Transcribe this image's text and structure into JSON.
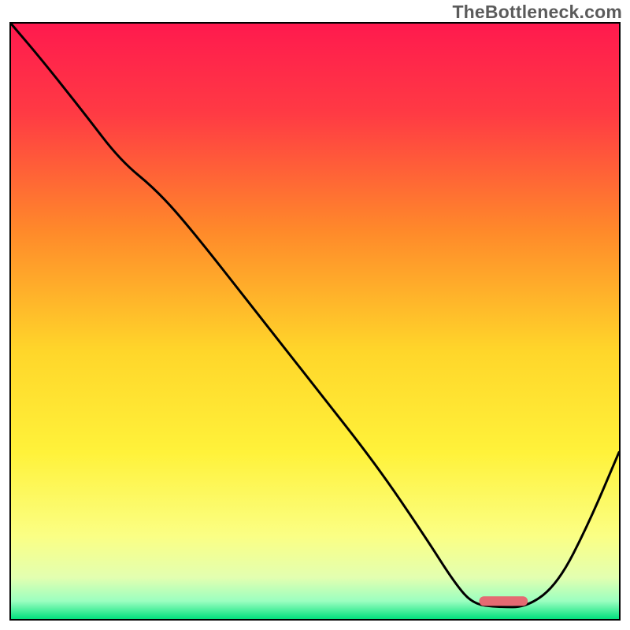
{
  "attribution": "TheBottleneck.com",
  "chart_data": {
    "type": "line",
    "title": "",
    "xlabel": "",
    "ylabel": "",
    "xlim": [
      0,
      100
    ],
    "ylim": [
      0,
      100
    ],
    "grid": false,
    "legend": false,
    "background_gradient": {
      "stops": [
        {
          "offset": 0.0,
          "color": "#ff1a4e"
        },
        {
          "offset": 0.15,
          "color": "#ff3a44"
        },
        {
          "offset": 0.35,
          "color": "#ff8a2a"
        },
        {
          "offset": 0.55,
          "color": "#ffd62a"
        },
        {
          "offset": 0.72,
          "color": "#fff23a"
        },
        {
          "offset": 0.86,
          "color": "#fbff84"
        },
        {
          "offset": 0.93,
          "color": "#e3ffb0"
        },
        {
          "offset": 0.97,
          "color": "#9bffc0"
        },
        {
          "offset": 1.0,
          "color": "#02e07d"
        }
      ]
    },
    "series": [
      {
        "name": "bottleneck-curve",
        "color": "#000000",
        "x": [
          0,
          5,
          12,
          18,
          24,
          30,
          40,
          50,
          60,
          68,
          73,
          76,
          80,
          85,
          90,
          95,
          100
        ],
        "values": [
          100,
          94,
          85,
          77,
          72,
          65,
          52,
          39,
          26,
          14,
          6,
          2.5,
          2,
          2,
          6,
          16,
          28
        ]
      }
    ],
    "marker": {
      "name": "optimal-range",
      "shape": "rounded-bar",
      "color": "#e46a72",
      "x_start": 77,
      "x_end": 85,
      "y": 3,
      "thickness_pct": 1.6
    }
  }
}
